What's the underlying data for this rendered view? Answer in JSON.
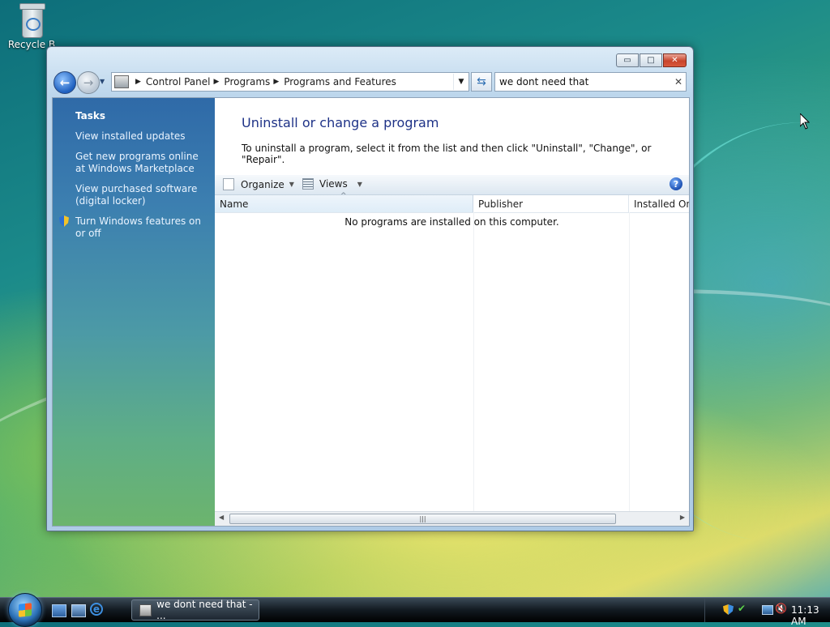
{
  "desktop": {
    "recycle_bin_label": "Recycle B"
  },
  "window": {
    "caption_buttons": {
      "minimize": "▭",
      "maximize": "□",
      "close": "✕"
    },
    "navigation": {
      "back_glyph": "←",
      "forward_glyph": "→",
      "breadcrumb": [
        "Control Panel",
        "Programs",
        "Programs and Features"
      ],
      "refresh_glyph": "⇆",
      "search_value": "we dont need that",
      "search_clear": "✕"
    },
    "tasks": {
      "title": "Tasks",
      "links": [
        "View installed updates",
        "Get new programs online at Windows Marketplace",
        "View purchased software (digital locker)",
        "Turn Windows features on or off"
      ]
    },
    "main": {
      "title": "Uninstall or change a program",
      "description": "To uninstall a program, select it from the list and then click \"Uninstall\", \"Change\", or \"Repair\".",
      "toolbar": {
        "organize": "Organize",
        "views": "Views",
        "help": "?"
      },
      "columns": [
        "Name",
        "Publisher",
        "Installed On"
      ],
      "empty_message": "No programs are installed on this computer."
    }
  },
  "taskbar": {
    "task_label": "we dont need that - ...",
    "clock": "11:13 AM"
  },
  "colors": {
    "title_text": "#1e3287",
    "task_pane_top": "#2f6aa8",
    "task_pane_bottom": "#6cb46d",
    "close_button": "#c8442c"
  },
  "icons": [
    "recycle-bin-icon",
    "back-arrow-icon",
    "forward-arrow-icon",
    "folder-icon",
    "refresh-icon",
    "clear-icon",
    "shield-icon",
    "organize-icon",
    "views-icon",
    "help-icon",
    "start-orb-icon",
    "show-desktop-icon",
    "switch-windows-icon",
    "internet-explorer-icon",
    "security-shield-icon",
    "network-icon",
    "volume-muted-icon",
    "mouse-cursor-icon"
  ]
}
